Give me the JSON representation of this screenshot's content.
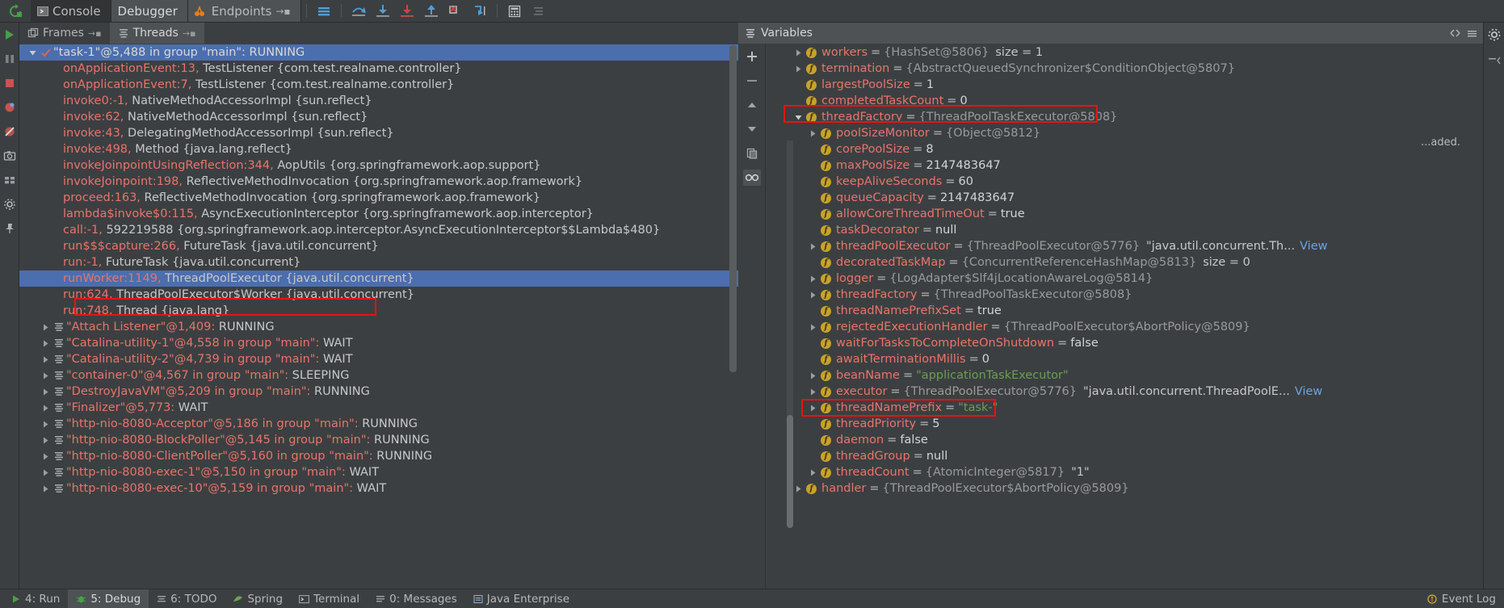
{
  "toolbar": {
    "rerun_icon": "rerun-icon",
    "tabs": [
      {
        "label": "Console",
        "icon": "console-icon",
        "active": false
      },
      {
        "label": "Debugger",
        "icon": "",
        "active": true
      },
      {
        "label": "Endpoints",
        "icon": "endpoints-icon",
        "active": false
      }
    ],
    "buttons": [
      "layout-icon",
      "step-over-icon",
      "step-into-icon",
      "force-step-into-icon",
      "step-out-icon",
      "run-to-cursor-icon",
      "evaluate-expression-icon",
      "calculator-icon",
      "settings-list-icon"
    ]
  },
  "left_rail": {
    "icons": [
      "resume-program-icon",
      "pause-program-icon",
      "stop-icon",
      "view-breakpoints-icon",
      "mute-breakpoints-icon",
      "camera-icon",
      "layout-grid-icon",
      "settings-gear-icon",
      "pin-icon"
    ]
  },
  "frames_panel": {
    "tabs": [
      {
        "label": "Frames",
        "icon": "frames-icon",
        "selected": false
      },
      {
        "label": "Threads",
        "icon": "threads-icon",
        "selected": true
      }
    ],
    "selected_thread": {
      "name": "\"task-1\"@5,488 in group \"main\": RUNNING",
      "icon": "thread-running-check-icon",
      "expanded": true
    },
    "stack_frames": [
      {
        "method": "onApplicationEvent:13,",
        "rest": "TestListener {com.test.realname.controller}"
      },
      {
        "method": "onApplicationEvent:7,",
        "rest": "TestListener {com.test.realname.controller}"
      },
      {
        "method": "invoke0:-1,",
        "rest": "NativeMethodAccessorImpl {sun.reflect}"
      },
      {
        "method": "invoke:62,",
        "rest": "NativeMethodAccessorImpl {sun.reflect}"
      },
      {
        "method": "invoke:43,",
        "rest": "DelegatingMethodAccessorImpl {sun.reflect}"
      },
      {
        "method": "invoke:498,",
        "rest": "Method {java.lang.reflect}"
      },
      {
        "method": "invokeJoinpointUsingReflection:344,",
        "rest": "AopUtils {org.springframework.aop.support}"
      },
      {
        "method": "invokeJoinpoint:198,",
        "rest": "ReflectiveMethodInvocation {org.springframework.aop.framework}"
      },
      {
        "method": "proceed:163,",
        "rest": "ReflectiveMethodInvocation {org.springframework.aop.framework}"
      },
      {
        "method": "lambda$invoke$0:115,",
        "rest": "AsyncExecutionInterceptor {org.springframework.aop.interceptor}"
      },
      {
        "method": "call:-1,",
        "rest": "592219588 {org.springframework.aop.interceptor.AsyncExecutionInterceptor$$Lambda$480}"
      },
      {
        "method": "run$$$capture:266,",
        "rest": "FutureTask {java.util.concurrent}"
      },
      {
        "method": "run:-1,",
        "rest": "FutureTask {java.util.concurrent}"
      },
      {
        "method": "runWorker:1149,",
        "rest": "ThreadPoolExecutor {java.util.concurrent}",
        "selected": true,
        "annotated": true
      },
      {
        "method": "run:624,",
        "rest": "ThreadPoolExecutor$Worker {java.util.concurrent}"
      },
      {
        "method": "run:748,",
        "rest": "Thread {java.lang}"
      }
    ],
    "other_threads": [
      {
        "name": "\"Attach Listener\"@1,409:",
        "state": "RUNNING"
      },
      {
        "name": "\"Catalina-utility-1\"@4,558 in group \"main\":",
        "state": "WAIT"
      },
      {
        "name": "\"Catalina-utility-2\"@4,739 in group \"main\":",
        "state": "WAIT"
      },
      {
        "name": "\"container-0\"@4,567 in group \"main\":",
        "state": "SLEEPING"
      },
      {
        "name": "\"DestroyJavaVM\"@5,209 in group \"main\":",
        "state": "RUNNING"
      },
      {
        "name": "\"Finalizer\"@5,773:",
        "state": "WAIT"
      },
      {
        "name": "\"http-nio-8080-Acceptor\"@5,186 in group \"main\":",
        "state": "RUNNING"
      },
      {
        "name": "\"http-nio-8080-BlockPoller\"@5,145 in group \"main\":",
        "state": "RUNNING"
      },
      {
        "name": "\"http-nio-8080-ClientPoller\"@5,160 in group \"main\":",
        "state": "RUNNING"
      },
      {
        "name": "\"http-nio-8080-exec-1\"@5,150 in group \"main\":",
        "state": "WAIT"
      },
      {
        "name": "\"http-nio-8080-exec-10\"@5,159 in group \"main\":",
        "state": "WAIT"
      }
    ]
  },
  "variables_panel": {
    "title": "Variables",
    "title_icon": "variables-icon",
    "side_buttons": [
      "add-watch-icon",
      "remove-watch-icon",
      "up-arrow-icon",
      "down-arrow-icon",
      "copy-icon",
      "inspect-icon"
    ],
    "header_buttons": [
      "expand-collapse-icon",
      "menu-icon"
    ],
    "rows": [
      {
        "indent": 0,
        "arrow": "right",
        "name": "workers",
        "value": "{HashSet@5806}",
        "vtype": "ref",
        "extra": "size = 1"
      },
      {
        "indent": 0,
        "arrow": "right",
        "name": "termination",
        "value": "{AbstractQueuedSynchronizer$ConditionObject@5807}",
        "vtype": "ref"
      },
      {
        "indent": 0,
        "arrow": "none",
        "name": "largestPoolSize",
        "value": "1",
        "vtype": "num"
      },
      {
        "indent": 0,
        "arrow": "none",
        "name": "completedTaskCount",
        "value": "0",
        "vtype": "num"
      },
      {
        "indent": 0,
        "arrow": "down",
        "name": "threadFactory",
        "value": "{ThreadPoolTaskExecutor@5808}",
        "vtype": "ref",
        "annotated": true
      },
      {
        "indent": 1,
        "arrow": "right",
        "name": "poolSizeMonitor",
        "value": "{Object@5812}",
        "vtype": "ref"
      },
      {
        "indent": 1,
        "arrow": "none",
        "name": "corePoolSize",
        "value": "8",
        "vtype": "num"
      },
      {
        "indent": 1,
        "arrow": "none",
        "name": "maxPoolSize",
        "value": "2147483647",
        "vtype": "num"
      },
      {
        "indent": 1,
        "arrow": "none",
        "name": "keepAliveSeconds",
        "value": "60",
        "vtype": "num"
      },
      {
        "indent": 1,
        "arrow": "none",
        "name": "queueCapacity",
        "value": "2147483647",
        "vtype": "num"
      },
      {
        "indent": 1,
        "arrow": "none",
        "name": "allowCoreThreadTimeOut",
        "value": "true",
        "vtype": "num"
      },
      {
        "indent": 1,
        "arrow": "none",
        "name": "taskDecorator",
        "value": "null",
        "vtype": "num"
      },
      {
        "indent": 1,
        "arrow": "right",
        "name": "threadPoolExecutor",
        "value": "{ThreadPoolExecutor@5776}",
        "vtype": "ref",
        "trailing": "\"java.util.concurrent.Th...",
        "view": "View"
      },
      {
        "indent": 1,
        "arrow": "none",
        "name": "decoratedTaskMap",
        "value": "{ConcurrentReferenceHashMap@5813}",
        "vtype": "ref",
        "extra": "size = 0"
      },
      {
        "indent": 1,
        "arrow": "right",
        "name": "logger",
        "value": "{LogAdapter$Slf4jLocationAwareLog@5814}",
        "vtype": "ref"
      },
      {
        "indent": 1,
        "arrow": "right",
        "name": "threadFactory",
        "value": "{ThreadPoolTaskExecutor@5808}",
        "vtype": "ref"
      },
      {
        "indent": 1,
        "arrow": "none",
        "name": "threadNamePrefixSet",
        "value": "true",
        "vtype": "num"
      },
      {
        "indent": 1,
        "arrow": "right",
        "name": "rejectedExecutionHandler",
        "value": "{ThreadPoolExecutor$AbortPolicy@5809}",
        "vtype": "ref"
      },
      {
        "indent": 1,
        "arrow": "none",
        "name": "waitForTasksToCompleteOnShutdown",
        "value": "false",
        "vtype": "num"
      },
      {
        "indent": 1,
        "arrow": "none",
        "name": "awaitTerminationMillis",
        "value": "0",
        "vtype": "num"
      },
      {
        "indent": 1,
        "arrow": "right",
        "name": "beanName",
        "value": "\"applicationTaskExecutor\"",
        "vtype": "str"
      },
      {
        "indent": 1,
        "arrow": "right",
        "name": "executor",
        "value": "{ThreadPoolExecutor@5776}",
        "vtype": "ref",
        "trailing": "\"java.util.concurrent.ThreadPoolE...",
        "view": "View"
      },
      {
        "indent": 1,
        "arrow": "right",
        "name": "threadNamePrefix",
        "value": "\"task-\"",
        "vtype": "str",
        "annotated": true
      },
      {
        "indent": 1,
        "arrow": "none",
        "name": "threadPriority",
        "value": "5",
        "vtype": "num"
      },
      {
        "indent": 1,
        "arrow": "none",
        "name": "daemon",
        "value": "false",
        "vtype": "num"
      },
      {
        "indent": 1,
        "arrow": "none",
        "name": "threadGroup",
        "value": "null",
        "vtype": "num"
      },
      {
        "indent": 1,
        "arrow": "right",
        "name": "threadCount",
        "value": "{AtomicInteger@5817}",
        "vtype": "ref",
        "extra": "\"1\""
      },
      {
        "indent": 0,
        "arrow": "right",
        "name": "handler",
        "value": "{ThreadPoolExecutor$AbortPolicy@5809}",
        "vtype": "ref"
      }
    ],
    "float_note": "...aded."
  },
  "status_bar": {
    "items": [
      {
        "label": "4: Run",
        "icon": "run-icon",
        "active": false
      },
      {
        "label": "5: Debug",
        "icon": "debug-icon",
        "active": true
      },
      {
        "label": "6: TODO",
        "icon": "todo-icon",
        "active": false
      },
      {
        "label": "Spring",
        "icon": "spring-icon",
        "active": false
      },
      {
        "label": "Terminal",
        "icon": "terminal-icon",
        "active": false
      },
      {
        "label": "0: Messages",
        "icon": "messages-icon",
        "active": false
      },
      {
        "label": "Java Enterprise",
        "icon": "java-enterprise-icon",
        "active": false
      }
    ],
    "right": {
      "label": "Event Log",
      "icon": "event-log-icon"
    }
  },
  "colors": {
    "background": "#3c3f41",
    "selection": "#4b6eaf",
    "annotation": "#ee1111",
    "identifier": "#e8746b",
    "string": "#6a9f52",
    "reference": "#9a9a9a"
  }
}
